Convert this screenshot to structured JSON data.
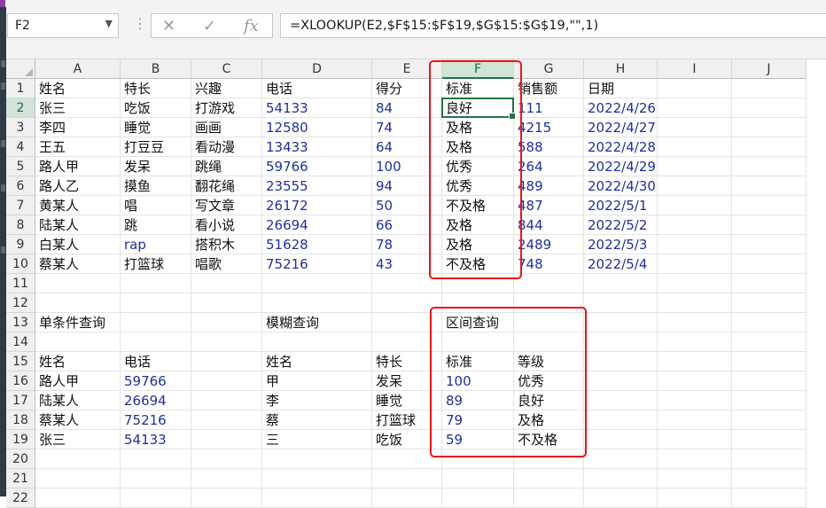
{
  "name_box": "F2",
  "formula": "=XLOOKUP(E2,$F$15:$F$19,$G$15:$G$19,\"\",1)",
  "columns": [
    "A",
    "B",
    "C",
    "D",
    "E",
    "F",
    "G",
    "H",
    "I",
    "J"
  ],
  "rows": [
    "1",
    "2",
    "3",
    "4",
    "5",
    "6",
    "7",
    "8",
    "9",
    "10",
    "11",
    "12",
    "13",
    "14",
    "15",
    "16",
    "17",
    "18",
    "19",
    "20",
    "21",
    "22"
  ],
  "table_headers": [
    "姓名",
    "特长",
    "兴趣",
    "电话",
    "得分",
    "标准",
    "销售额",
    "日期"
  ],
  "table_rows": [
    [
      "张三",
      "吃饭",
      "打游戏",
      "54133",
      "84",
      "良好",
      "111",
      "2022/4/26"
    ],
    [
      "李四",
      "睡觉",
      "画画",
      "12580",
      "74",
      "及格",
      "4215",
      "2022/4/27"
    ],
    [
      "王五",
      "打豆豆",
      "看动漫",
      "13433",
      "64",
      "及格",
      "588",
      "2022/4/28"
    ],
    [
      " 路人甲",
      "发呆",
      "跳绳",
      "59766",
      "100",
      "优秀",
      "264",
      "2022/4/29"
    ],
    [
      "路人乙",
      "摸鱼",
      "翻花绳",
      "23555",
      "94",
      "优秀",
      "489",
      "2022/4/30"
    ],
    [
      "黄某人",
      "唱",
      "写文章",
      "26172",
      "50",
      "不及格",
      "487",
      "2022/5/1"
    ],
    [
      "陆某人",
      "跳",
      "看小说",
      "26694",
      "66",
      "及格",
      "844",
      "2022/5/2"
    ],
    [
      "白某人",
      "rap",
      "搭积木",
      "51628",
      "78",
      "及格",
      "2489",
      "2022/5/3"
    ],
    [
      "蔡某人",
      "打篮球",
      "唱歌",
      "75216",
      "43",
      "不及格",
      "748",
      "2022/5/4"
    ]
  ],
  "section_titles": {
    "single": "单条件查询",
    "fuzzy": "模糊查询",
    "range": "区间查询"
  },
  "single_headers": [
    "姓名",
    "电话"
  ],
  "single_rows": [
    [
      " 路人甲",
      "59766"
    ],
    [
      "陆某人",
      "26694"
    ],
    [
      "蔡某人",
      "75216"
    ],
    [
      "张三",
      "54133"
    ]
  ],
  "fuzzy_headers": [
    "姓名",
    "特长"
  ],
  "fuzzy_rows": [
    [
      "甲",
      "发呆"
    ],
    [
      "李",
      "睡觉"
    ],
    [
      "蔡",
      "打篮球"
    ],
    [
      "三",
      "吃饭"
    ]
  ],
  "range_headers": [
    "标准",
    "等级"
  ],
  "range_rows": [
    [
      "100",
      "优秀"
    ],
    [
      "89",
      "良好"
    ],
    [
      "79",
      "及格"
    ],
    [
      "59",
      "不及格"
    ]
  ],
  "highlight_color": "#e8151b",
  "accent_color": "#217346"
}
